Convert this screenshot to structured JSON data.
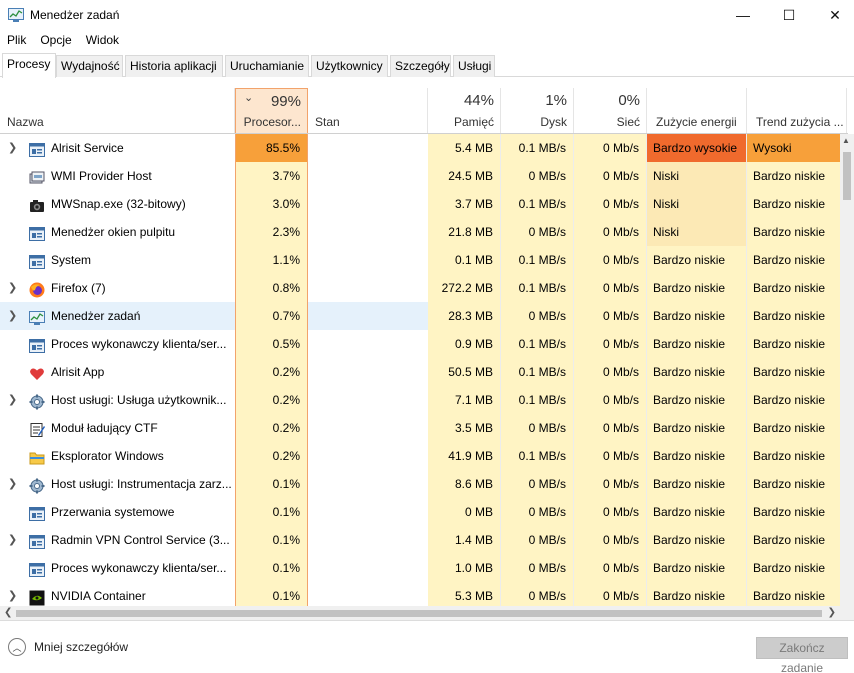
{
  "window": {
    "title": "Menedżer zadań",
    "min": "—",
    "max": "☐",
    "close": "✕"
  },
  "menu": [
    "Plik",
    "Opcje",
    "Widok"
  ],
  "tabs": [
    "Procesy",
    "Wydajność",
    "Historia aplikacji",
    "Uruchamianie",
    "Użytkownicy",
    "Szczegóły",
    "Usługi"
  ],
  "columns": {
    "name": {
      "label": "Nazwa"
    },
    "cpu": {
      "pct": "99%",
      "label": "Procesor..."
    },
    "status": {
      "label": "Stan"
    },
    "memory": {
      "pct": "44%",
      "label": "Pamięć"
    },
    "disk": {
      "pct": "1%",
      "label": "Dysk"
    },
    "network": {
      "pct": "0%",
      "label": "Sieć"
    },
    "power": {
      "label": "Zużycie energii"
    },
    "trend": {
      "label": "Trend zużycia ..."
    }
  },
  "rows": [
    {
      "name": "Alrisit Service",
      "expand": true,
      "icon": "service-icon",
      "cpu": "85.5%",
      "mem": "5.4 MB",
      "disk": "0.1 MB/s",
      "net": "0 Mb/s",
      "power": "Bardzo wysokie",
      "trend": "Wysoki"
    },
    {
      "name": "WMI Provider Host",
      "expand": false,
      "icon": "wmi-icon",
      "cpu": "3.7%",
      "mem": "24.5 MB",
      "disk": "0 MB/s",
      "net": "0 Mb/s",
      "power": "Niski",
      "trend": "Bardzo niskie"
    },
    {
      "name": "MWSnap.exe (32-bitowy)",
      "expand": false,
      "icon": "camera-icon",
      "cpu": "3.0%",
      "mem": "3.7 MB",
      "disk": "0.1 MB/s",
      "net": "0 Mb/s",
      "power": "Niski",
      "trend": "Bardzo niskie"
    },
    {
      "name": "Menedżer okien pulpitu",
      "expand": false,
      "icon": "service-icon",
      "cpu": "2.3%",
      "mem": "21.8 MB",
      "disk": "0 MB/s",
      "net": "0 Mb/s",
      "power": "Niski",
      "trend": "Bardzo niskie"
    },
    {
      "name": "System",
      "expand": false,
      "icon": "service-icon",
      "cpu": "1.1%",
      "mem": "0.1 MB",
      "disk": "0.1 MB/s",
      "net": "0 Mb/s",
      "power": "Bardzo niskie",
      "trend": "Bardzo niskie"
    },
    {
      "name": "Firefox (7)",
      "expand": true,
      "icon": "firefox-icon",
      "cpu": "0.8%",
      "mem": "272.2 MB",
      "disk": "0.1 MB/s",
      "net": "0 Mb/s",
      "power": "Bardzo niskie",
      "trend": "Bardzo niskie"
    },
    {
      "name": "Menedżer zadań",
      "expand": true,
      "icon": "taskmanager-icon",
      "cpu": "0.7%",
      "mem": "28.3 MB",
      "disk": "0 MB/s",
      "net": "0 Mb/s",
      "power": "Bardzo niskie",
      "trend": "Bardzo niskie",
      "selected": true
    },
    {
      "name": "Proces wykonawczy klienta/ser...",
      "expand": false,
      "icon": "service-icon",
      "cpu": "0.5%",
      "mem": "0.9 MB",
      "disk": "0.1 MB/s",
      "net": "0 Mb/s",
      "power": "Bardzo niskie",
      "trend": "Bardzo niskie"
    },
    {
      "name": "Alrisit App",
      "expand": false,
      "icon": "heart-icon",
      "cpu": "0.2%",
      "mem": "50.5 MB",
      "disk": "0.1 MB/s",
      "net": "0 Mb/s",
      "power": "Bardzo niskie",
      "trend": "Bardzo niskie"
    },
    {
      "name": "Host usługi: Usługa użytkownik...",
      "expand": true,
      "icon": "gear-icon",
      "cpu": "0.2%",
      "mem": "7.1 MB",
      "disk": "0.1 MB/s",
      "net": "0 Mb/s",
      "power": "Bardzo niskie",
      "trend": "Bardzo niskie"
    },
    {
      "name": "Moduł ładujący CTF",
      "expand": false,
      "icon": "ctf-icon",
      "cpu": "0.2%",
      "mem": "3.5 MB",
      "disk": "0 MB/s",
      "net": "0 Mb/s",
      "power": "Bardzo niskie",
      "trend": "Bardzo niskie"
    },
    {
      "name": "Eksplorator Windows",
      "expand": false,
      "icon": "folder-icon",
      "cpu": "0.2%",
      "mem": "41.9 MB",
      "disk": "0.1 MB/s",
      "net": "0 Mb/s",
      "power": "Bardzo niskie",
      "trend": "Bardzo niskie"
    },
    {
      "name": "Host usługi: Instrumentacja zarz...",
      "expand": true,
      "icon": "gear-icon",
      "cpu": "0.1%",
      "mem": "8.6 MB",
      "disk": "0 MB/s",
      "net": "0 Mb/s",
      "power": "Bardzo niskie",
      "trend": "Bardzo niskie"
    },
    {
      "name": "Przerwania systemowe",
      "expand": false,
      "icon": "service-icon",
      "cpu": "0.1%",
      "mem": "0 MB",
      "disk": "0 MB/s",
      "net": "0 Mb/s",
      "power": "Bardzo niskie",
      "trend": "Bardzo niskie"
    },
    {
      "name": "Radmin VPN Control Service (3...",
      "expand": true,
      "icon": "service-icon",
      "cpu": "0.1%",
      "mem": "1.4 MB",
      "disk": "0 MB/s",
      "net": "0 Mb/s",
      "power": "Bardzo niskie",
      "trend": "Bardzo niskie"
    },
    {
      "name": "Proces wykonawczy klienta/ser...",
      "expand": false,
      "icon": "service-icon",
      "cpu": "0.1%",
      "mem": "1.0 MB",
      "disk": "0 MB/s",
      "net": "0 Mb/s",
      "power": "Bardzo niskie",
      "trend": "Bardzo niskie"
    },
    {
      "name": "NVIDIA Container",
      "expand": true,
      "icon": "nvidia-icon",
      "cpu": "0.1%",
      "mem": "5.3 MB",
      "disk": "0 MB/s",
      "net": "0 Mb/s",
      "power": "Bardzo niskie",
      "trend": "Bardzo niskie"
    }
  ],
  "footer": {
    "less_details": "Mniej szczegółów",
    "end_task": "Zakończ zadanie"
  },
  "colors": {
    "cpu_high": "#f7a03a",
    "cpu_low": "#fff4c4",
    "power_very_high": "#f06a2d",
    "power_low": "#fce9b5",
    "power_very_low": "#fff4c4",
    "selected": "#e5f1fb"
  }
}
